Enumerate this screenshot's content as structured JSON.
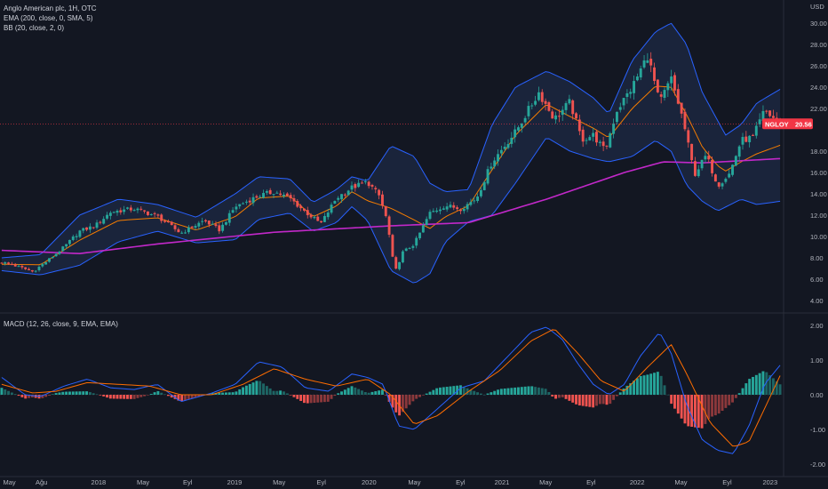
{
  "header": {
    "symbol_line": "Anglo American plc, 1H, OTC",
    "ema_line": "EMA (200, close, 0, SMA, 5)",
    "bb_line": "BB (20, close, 2, 0)",
    "macd_line": "MACD (12, 26, close, 9, EMA, EMA)",
    "currency": "USD"
  },
  "price_badge": {
    "ticker": "NGLOY",
    "value": "20.56",
    "color": "#f23645"
  },
  "colors": {
    "up": "#26a69a",
    "down": "#ef5350",
    "ema200": "#c228c9",
    "bb_line": "#2962ff",
    "bb_fill": "#1e2a44",
    "ema20": "#f57c00",
    "macd": "#2962ff",
    "signal": "#ff6d00",
    "hist_up": "#26a69a",
    "hist_down": "#ef5350",
    "background": "#131722"
  },
  "chart_data": [
    {
      "type": "candlestick",
      "ylim": [
        3.5,
        31.5
      ],
      "y_ticks": [
        "4.00",
        "6.00",
        "8.00",
        "10.00",
        "12.00",
        "14.00",
        "16.00",
        "18.00",
        "20.00",
        "22.00",
        "24.00",
        "26.00",
        "28.00",
        "30.00"
      ],
      "x_ticks": [
        "May",
        "Ağu",
        "2018",
        "May",
        "Eyl",
        "2019",
        "May",
        "Eyl",
        "2020",
        "May",
        "Eyl",
        "2021",
        "May",
        "Eyl",
        "2022",
        "May",
        "Eyl",
        "2023"
      ],
      "last_price": 20.56,
      "close_anchors": [
        [
          0,
          7.6
        ],
        [
          0.02,
          7.2
        ],
        [
          0.04,
          6.7
        ],
        [
          0.06,
          7.8
        ],
        [
          0.08,
          9.0
        ],
        [
          0.1,
          10.5
        ],
        [
          0.12,
          11.0
        ],
        [
          0.14,
          12.3
        ],
        [
          0.17,
          12.6
        ],
        [
          0.2,
          11.9
        ],
        [
          0.23,
          10.3
        ],
        [
          0.26,
          11.5
        ],
        [
          0.28,
          10.6
        ],
        [
          0.3,
          12.8
        ],
        [
          0.33,
          13.8
        ],
        [
          0.35,
          14.2
        ],
        [
          0.37,
          13.6
        ],
        [
          0.39,
          12.3
        ],
        [
          0.41,
          11.2
        ],
        [
          0.43,
          13.6
        ],
        [
          0.45,
          14.6
        ],
        [
          0.47,
          15.1
        ],
        [
          0.485,
          13.8
        ],
        [
          0.495,
          11.5
        ],
        [
          0.505,
          6.6
        ],
        [
          0.515,
          8.5
        ],
        [
          0.53,
          9.3
        ],
        [
          0.55,
          12.2
        ],
        [
          0.57,
          12.9
        ],
        [
          0.59,
          12.6
        ],
        [
          0.61,
          13.6
        ],
        [
          0.63,
          17.0
        ],
        [
          0.66,
          19.8
        ],
        [
          0.69,
          23.5
        ],
        [
          0.71,
          21.0
        ],
        [
          0.73,
          22.6
        ],
        [
          0.745,
          19.1
        ],
        [
          0.76,
          19.5
        ],
        [
          0.775,
          18.0
        ],
        [
          0.79,
          21.8
        ],
        [
          0.81,
          24.0
        ],
        [
          0.83,
          27.0
        ],
        [
          0.845,
          22.5
        ],
        [
          0.86,
          24.8
        ],
        [
          0.875,
          21.0
        ],
        [
          0.89,
          15.8
        ],
        [
          0.905,
          17.6
        ],
        [
          0.92,
          14.8
        ],
        [
          0.935,
          15.9
        ],
        [
          0.95,
          19.0
        ],
        [
          0.965,
          19.3
        ],
        [
          0.98,
          21.8
        ],
        [
          1.0,
          20.56
        ]
      ],
      "ema200_anchors": [
        [
          0,
          8.7
        ],
        [
          0.1,
          8.4
        ],
        [
          0.2,
          9.3
        ],
        [
          0.35,
          10.4
        ],
        [
          0.5,
          11.0
        ],
        [
          0.6,
          11.3
        ],
        [
          0.7,
          13.5
        ],
        [
          0.8,
          16.0
        ],
        [
          0.85,
          17.0
        ],
        [
          0.9,
          16.9
        ],
        [
          1.0,
          17.3
        ]
      ],
      "bb_upper_anchors": [
        [
          0,
          8.0
        ],
        [
          0.05,
          8.3
        ],
        [
          0.1,
          12.0
        ],
        [
          0.15,
          13.5
        ],
        [
          0.2,
          13.0
        ],
        [
          0.25,
          11.8
        ],
        [
          0.3,
          14.0
        ],
        [
          0.33,
          15.6
        ],
        [
          0.37,
          15.4
        ],
        [
          0.4,
          13.2
        ],
        [
          0.43,
          14.4
        ],
        [
          0.45,
          15.6
        ],
        [
          0.47,
          15.2
        ],
        [
          0.5,
          18.5
        ],
        [
          0.53,
          17.5
        ],
        [
          0.55,
          15.0
        ],
        [
          0.57,
          14.2
        ],
        [
          0.6,
          14.4
        ],
        [
          0.63,
          20.5
        ],
        [
          0.66,
          24.0
        ],
        [
          0.7,
          25.5
        ],
        [
          0.73,
          24.5
        ],
        [
          0.76,
          23.0
        ],
        [
          0.78,
          21.5
        ],
        [
          0.81,
          26.5
        ],
        [
          0.84,
          29.2
        ],
        [
          0.86,
          30.0
        ],
        [
          0.88,
          28.0
        ],
        [
          0.9,
          23.5
        ],
        [
          0.93,
          19.5
        ],
        [
          0.95,
          20.5
        ],
        [
          0.97,
          22.5
        ],
        [
          1.0,
          23.8
        ]
      ],
      "bb_lower_anchors": [
        [
          0,
          6.8
        ],
        [
          0.05,
          6.4
        ],
        [
          0.1,
          7.3
        ],
        [
          0.15,
          9.5
        ],
        [
          0.2,
          10.5
        ],
        [
          0.25,
          9.4
        ],
        [
          0.3,
          9.7
        ],
        [
          0.33,
          11.6
        ],
        [
          0.37,
          12.2
        ],
        [
          0.4,
          10.5
        ],
        [
          0.43,
          11.3
        ],
        [
          0.45,
          12.8
        ],
        [
          0.47,
          11.5
        ],
        [
          0.5,
          6.8
        ],
        [
          0.53,
          5.6
        ],
        [
          0.55,
          6.5
        ],
        [
          0.57,
          9.5
        ],
        [
          0.6,
          11.4
        ],
        [
          0.63,
          12.0
        ],
        [
          0.66,
          15.0
        ],
        [
          0.7,
          19.3
        ],
        [
          0.73,
          18.0
        ],
        [
          0.76,
          17.3
        ],
        [
          0.78,
          17.0
        ],
        [
          0.81,
          17.5
        ],
        [
          0.84,
          19.0
        ],
        [
          0.86,
          18.0
        ],
        [
          0.88,
          14.8
        ],
        [
          0.9,
          13.3
        ],
        [
          0.92,
          12.4
        ],
        [
          0.95,
          13.5
        ],
        [
          0.97,
          13.0
        ],
        [
          1.0,
          13.3
        ]
      ]
    },
    {
      "type": "macd",
      "ylim": [
        -2.15,
        2.15
      ],
      "y_ticks": [
        "2.00",
        "1.00",
        "0.00",
        "-1.00",
        "-2.00"
      ],
      "macd_anchors": [
        [
          0,
          0.5
        ],
        [
          0.03,
          0.0
        ],
        [
          0.05,
          -0.05
        ],
        [
          0.08,
          0.25
        ],
        [
          0.11,
          0.45
        ],
        [
          0.14,
          0.2
        ],
        [
          0.17,
          0.15
        ],
        [
          0.2,
          0.3
        ],
        [
          0.23,
          -0.2
        ],
        [
          0.27,
          0.05
        ],
        [
          0.3,
          0.3
        ],
        [
          0.33,
          0.95
        ],
        [
          0.36,
          0.8
        ],
        [
          0.39,
          0.2
        ],
        [
          0.42,
          0.1
        ],
        [
          0.45,
          0.6
        ],
        [
          0.47,
          0.5
        ],
        [
          0.49,
          0.3
        ],
        [
          0.51,
          -0.9
        ],
        [
          0.53,
          -1.0
        ],
        [
          0.56,
          -0.4
        ],
        [
          0.59,
          0.2
        ],
        [
          0.62,
          0.4
        ],
        [
          0.65,
          1.1
        ],
        [
          0.68,
          1.8
        ],
        [
          0.7,
          1.95
        ],
        [
          0.72,
          1.6
        ],
        [
          0.74,
          0.9
        ],
        [
          0.76,
          0.3
        ],
        [
          0.78,
          0.0
        ],
        [
          0.8,
          0.3
        ],
        [
          0.82,
          1.1
        ],
        [
          0.845,
          1.8
        ],
        [
          0.86,
          1.2
        ],
        [
          0.88,
          -0.3
        ],
        [
          0.9,
          -1.3
        ],
        [
          0.92,
          -1.6
        ],
        [
          0.94,
          -1.7
        ],
        [
          0.96,
          -0.9
        ],
        [
          0.98,
          0.3
        ],
        [
          1.0,
          0.85
        ]
      ],
      "signal_anchors": [
        [
          0,
          0.3
        ],
        [
          0.04,
          0.05
        ],
        [
          0.07,
          0.1
        ],
        [
          0.11,
          0.35
        ],
        [
          0.15,
          0.3
        ],
        [
          0.19,
          0.25
        ],
        [
          0.23,
          0.0
        ],
        [
          0.27,
          0.0
        ],
        [
          0.31,
          0.3
        ],
        [
          0.35,
          0.75
        ],
        [
          0.39,
          0.45
        ],
        [
          0.43,
          0.25
        ],
        [
          0.47,
          0.45
        ],
        [
          0.5,
          0.0
        ],
        [
          0.53,
          -0.85
        ],
        [
          0.56,
          -0.6
        ],
        [
          0.6,
          0.1
        ],
        [
          0.64,
          0.7
        ],
        [
          0.68,
          1.55
        ],
        [
          0.71,
          1.9
        ],
        [
          0.74,
          1.2
        ],
        [
          0.77,
          0.4
        ],
        [
          0.8,
          0.1
        ],
        [
          0.83,
          0.8
        ],
        [
          0.86,
          1.45
        ],
        [
          0.88,
          0.6
        ],
        [
          0.91,
          -0.8
        ],
        [
          0.94,
          -1.5
        ],
        [
          0.96,
          -1.35
        ],
        [
          0.98,
          -0.4
        ],
        [
          1.0,
          0.55
        ]
      ]
    }
  ]
}
